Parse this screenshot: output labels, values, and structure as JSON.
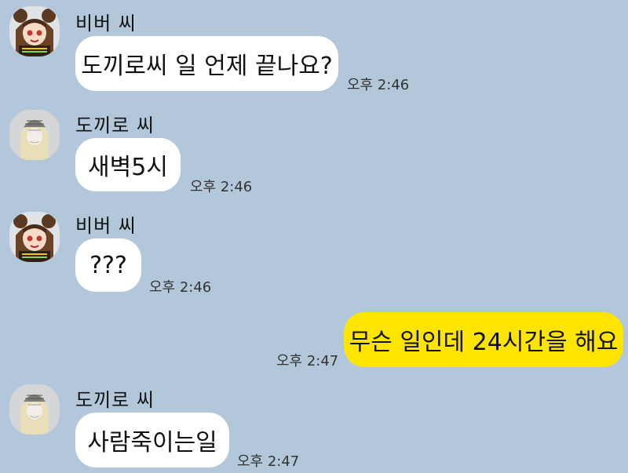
{
  "chat": {
    "senders": {
      "beaver": "비버 씨",
      "dokkiro": "도끼로 씨"
    },
    "messages": [
      {
        "sender": "비버 씨",
        "text": "도끼로씨 일 언제 끝나요?",
        "time": "오후 2:46"
      },
      {
        "sender": "도끼로 씨",
        "text": "새벽5시",
        "time": "오후 2:46"
      },
      {
        "sender": "비버 씨",
        "text": "???",
        "time": "오후 2:46"
      },
      {
        "sender": "me",
        "text": "무슨 일인데 24시간을 해요",
        "time": "오후 2:47"
      },
      {
        "sender": "도끼로 씨",
        "text": "사람죽이는일",
        "time": "오후 2:47"
      }
    ]
  },
  "colors": {
    "background": "#b2c7da",
    "bubble_other": "#ffffff",
    "bubble_me": "#fee500"
  },
  "icons": {
    "beaver_avatar": "beaver-avatar-icon",
    "dokkiro_avatar": "dokkiro-avatar-icon"
  }
}
